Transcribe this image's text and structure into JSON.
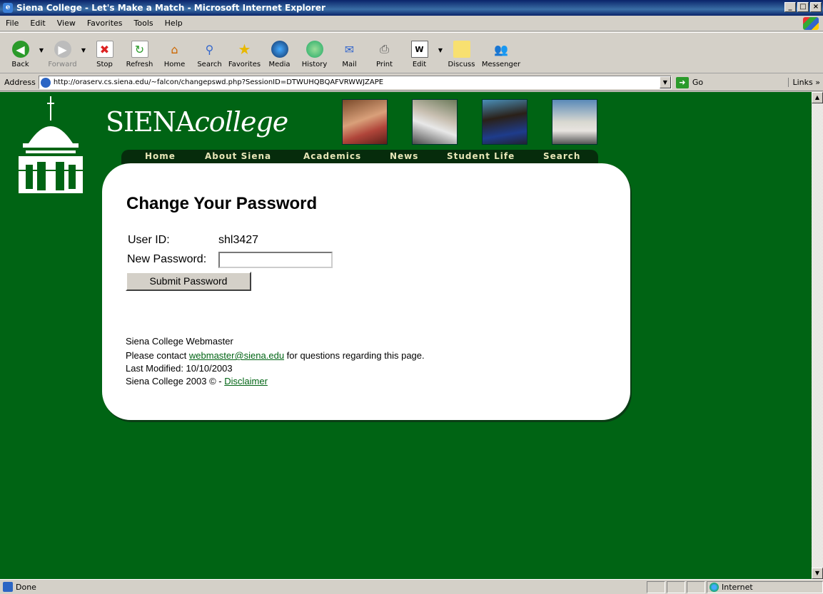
{
  "window": {
    "title": "Siena College - Let's Make a Match - Microsoft Internet Explorer"
  },
  "menu": [
    "File",
    "Edit",
    "View",
    "Favorites",
    "Tools",
    "Help"
  ],
  "toolbar": {
    "back": "Back",
    "forward": "Forward",
    "stop": "Stop",
    "refresh": "Refresh",
    "home": "Home",
    "search": "Search",
    "favorites": "Favorites",
    "media": "Media",
    "history": "History",
    "mail": "Mail",
    "print": "Print",
    "edit": "Edit",
    "discuss": "Discuss",
    "messenger": "Messenger"
  },
  "address": {
    "label": "Address",
    "url": "http://oraserv.cs.siena.edu/~falcon/changepswd.php?SessionID=DTWUHQBQAFVRWWJZAPE",
    "go": "Go",
    "links": "Links"
  },
  "site": {
    "logo_main": "SIENA",
    "logo_italic": "college",
    "nav": [
      "Home",
      "About Siena",
      "Academics",
      "News",
      "Student Life",
      "Search"
    ]
  },
  "form": {
    "title": "Change Your Password",
    "user_label": "User ID:",
    "user_value": "shl3427",
    "password_label": "New Password:",
    "password_value": "",
    "submit": "Submit Password"
  },
  "footer": {
    "line1": "Siena College Webmaster",
    "contact_pre": "Please contact ",
    "contact_email": "webmaster@siena.edu",
    "contact_post": " for questions regarding this page.",
    "modified": "Last Modified: 10/10/2003",
    "copyright": "Siena College 2003 © - ",
    "disclaimer": "Disclaimer"
  },
  "status": {
    "text": "Done",
    "zone": "Internet"
  },
  "colors": {
    "page_bg": "#006414",
    "nav_bg": "#062c0c",
    "nav_text": "#e8e6b8",
    "title_bar": "#0a246a"
  }
}
